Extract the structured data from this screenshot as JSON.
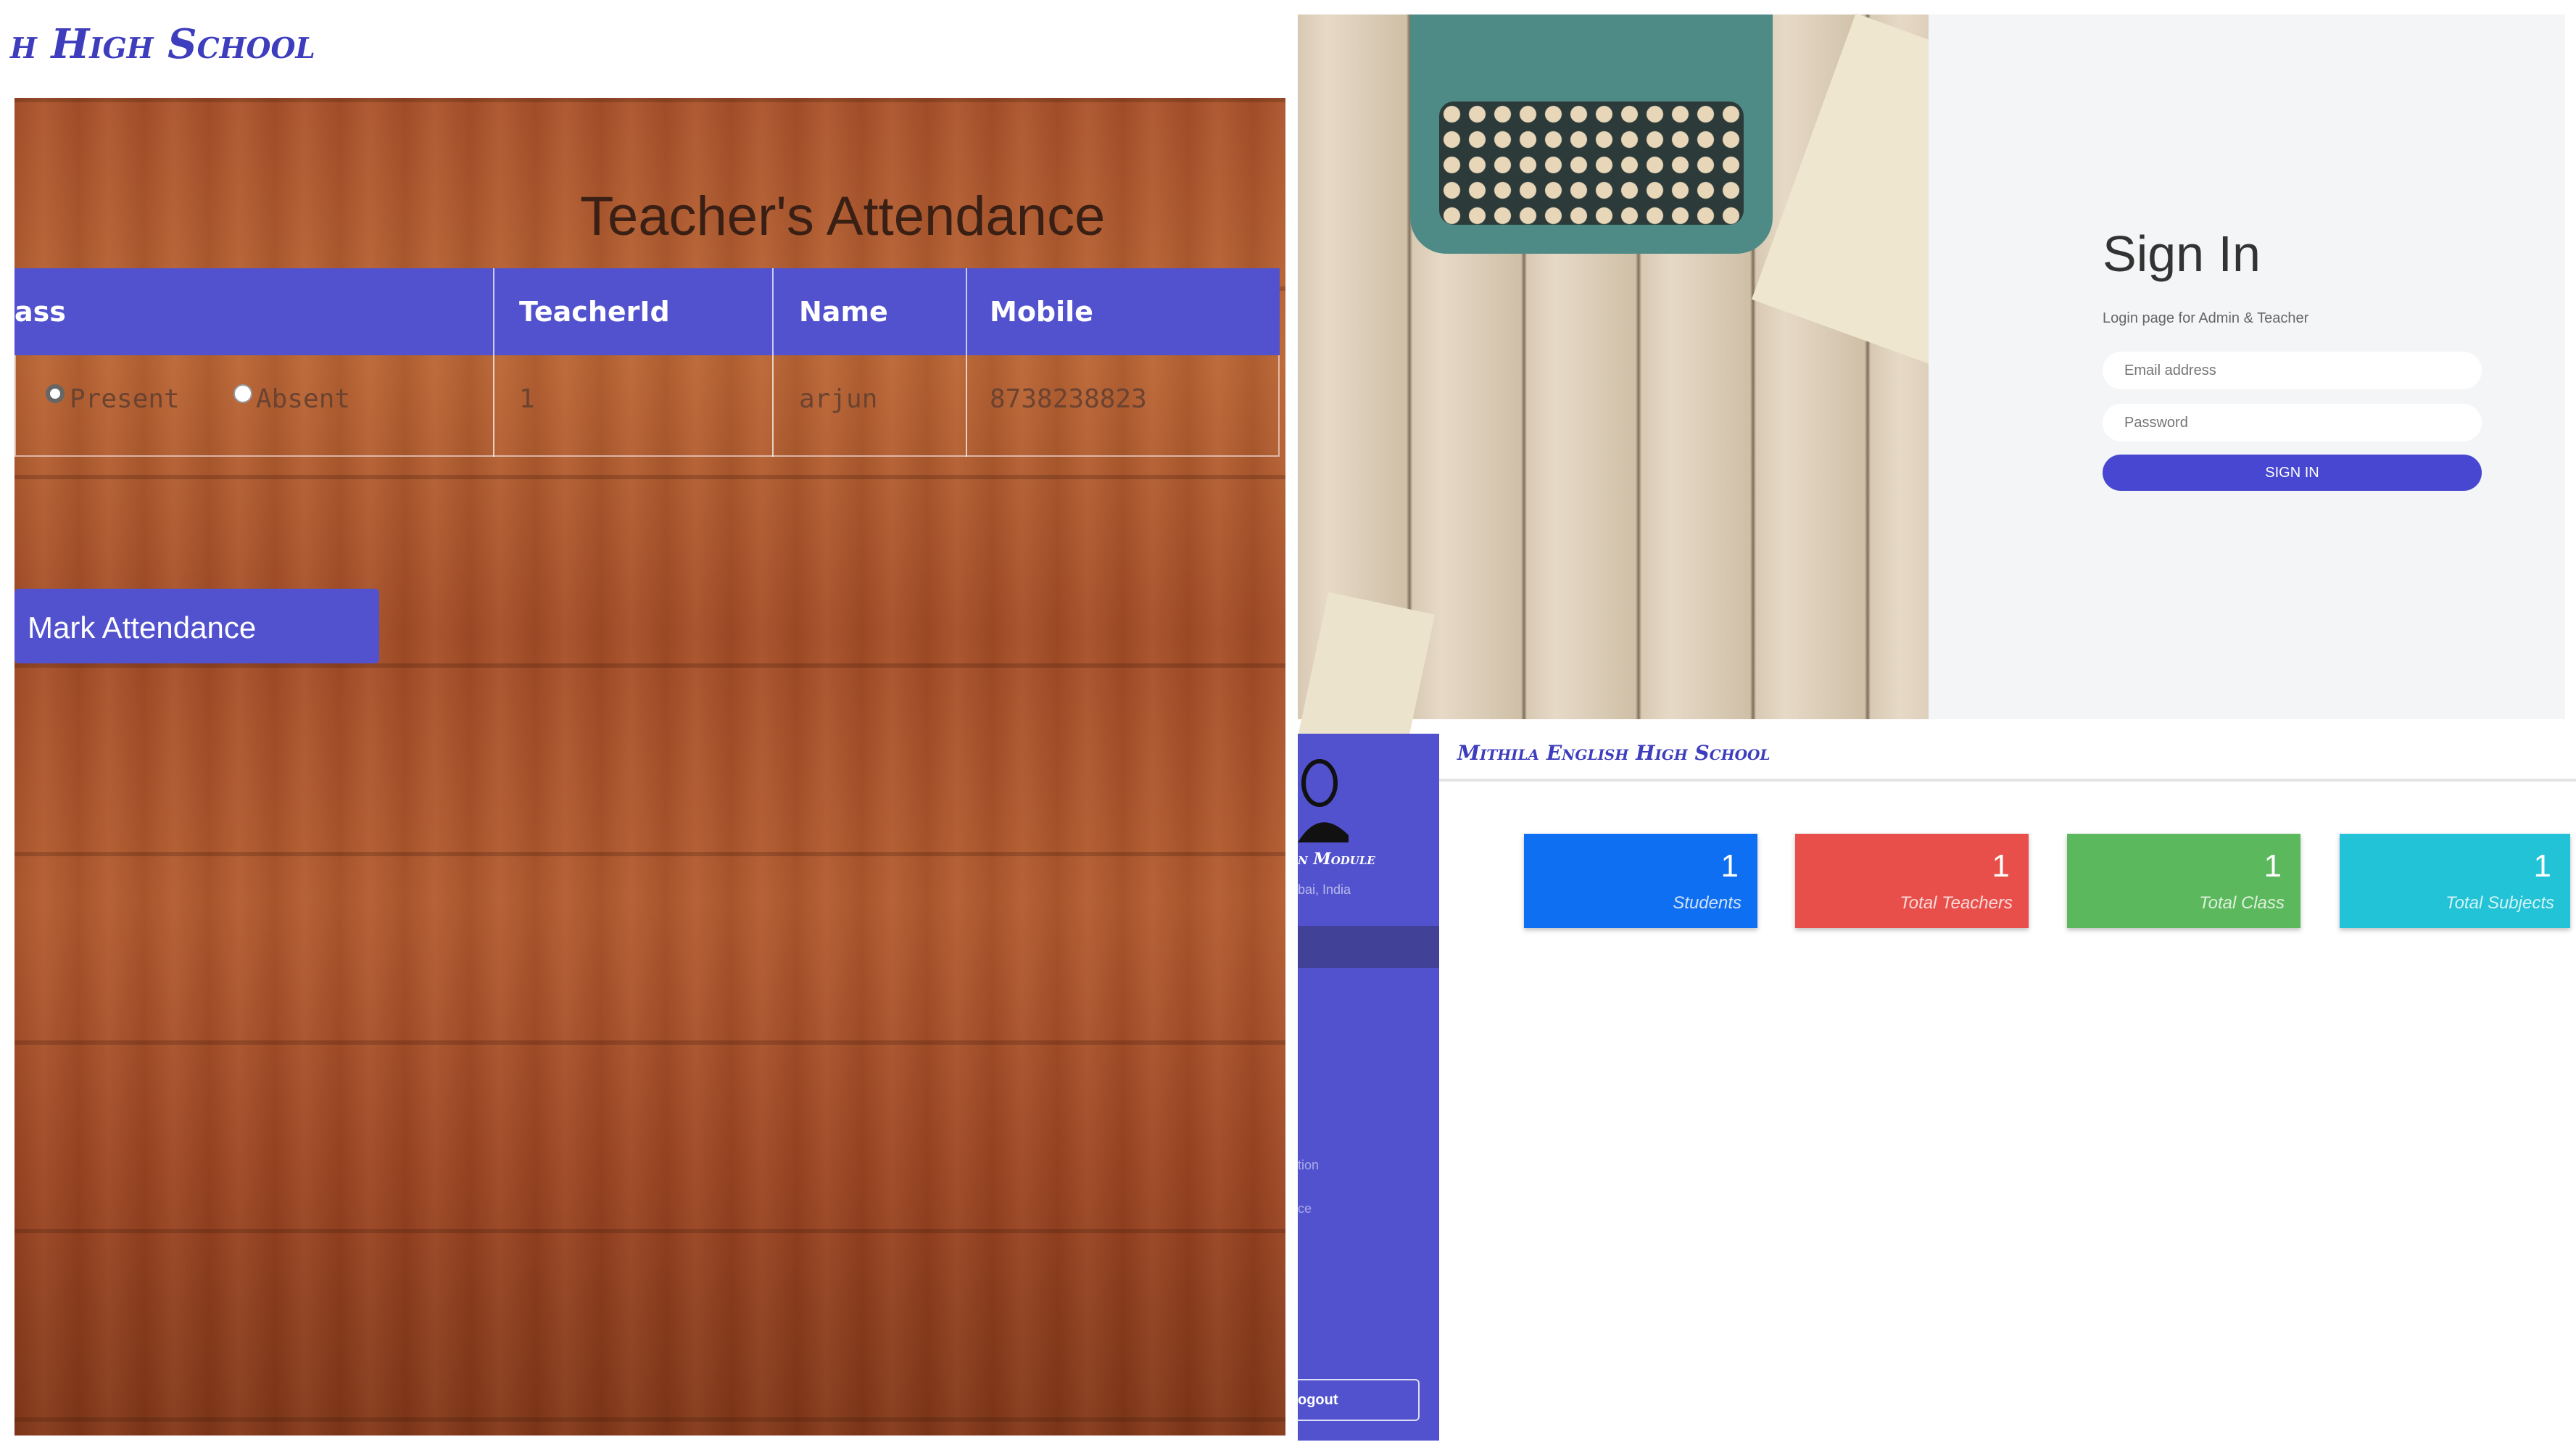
{
  "attendance": {
    "school_title": "h High School",
    "heading": "Teacher's Attendance",
    "columns": [
      "ass",
      "TeacherId",
      "Name",
      "Mobile"
    ],
    "row": {
      "present_label": "Present",
      "absent_label": "Absent",
      "teacher_id": "1",
      "name": "arjun",
      "mobile": "8738238823"
    },
    "mark_button": "Mark Attendance"
  },
  "signin": {
    "title": "Sign In",
    "subtitle": "Login page for Admin & Teacher",
    "email_placeholder": "Email address",
    "password_placeholder": "Password",
    "button": "SIGN IN"
  },
  "dashboard": {
    "school_title": "Mithila English High School",
    "sidebar": {
      "module": "n Module",
      "location": "bai, India",
      "item_a": "tion",
      "item_b": "ce",
      "logout": "ogout"
    },
    "cards": [
      {
        "value": "1",
        "label": "Students",
        "color": "#0f6ff2"
      },
      {
        "value": "1",
        "label": "Total Teachers",
        "color": "#e94f4a"
      },
      {
        "value": "1",
        "label": "Total Class",
        "color": "#5cb85c"
      },
      {
        "value": "1",
        "label": "Total Subjects",
        "color": "#22c3d6"
      }
    ]
  },
  "colors": {
    "accent": "#5252cf",
    "sidebar": "#5252cf"
  }
}
